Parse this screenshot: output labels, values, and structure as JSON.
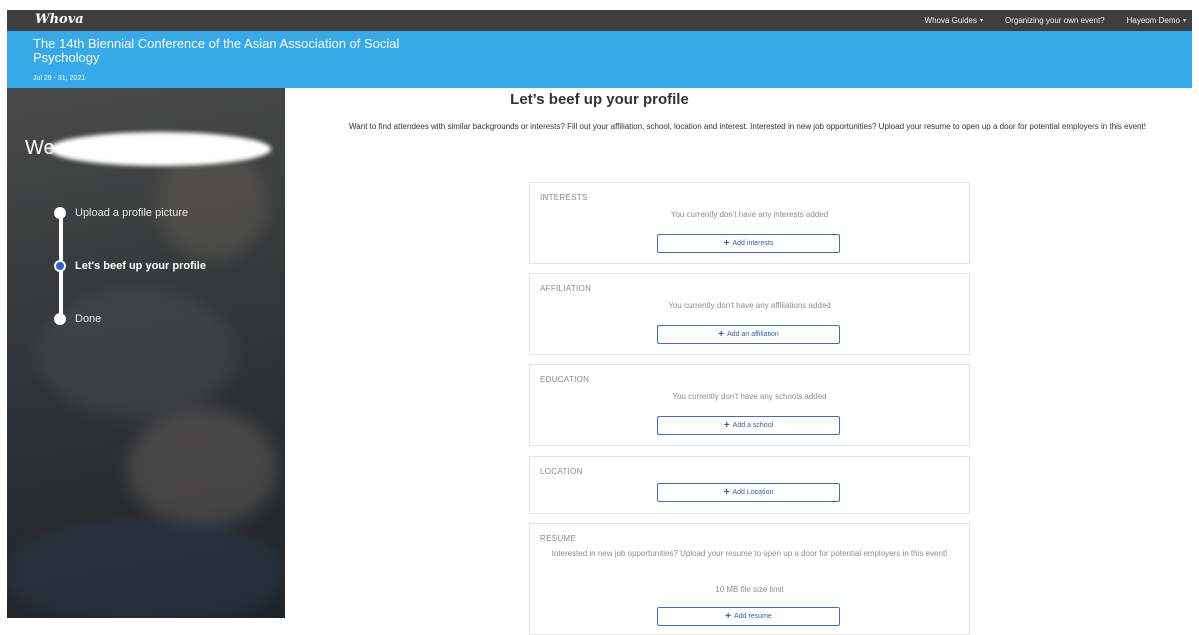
{
  "topbar": {
    "logo": "Whova",
    "nav": [
      {
        "label": "Whova Guides",
        "caret": "▾"
      },
      {
        "label": "Organizing your own event?",
        "caret": ""
      },
      {
        "label": "Hayeom Demo",
        "caret": "▾"
      }
    ]
  },
  "event": {
    "title": "The 14th Biennial Conference of the Asian Association of Social Psychology",
    "dates": "Jul 29 - 31, 2021"
  },
  "sidebar": {
    "welcome": "We                               mo!",
    "steps": [
      {
        "label": "Upload a profile picture",
        "active": false
      },
      {
        "label": "Let's beef up your profile",
        "active": true
      },
      {
        "label": "Done",
        "active": false
      }
    ]
  },
  "main": {
    "title": "Let’s beef up your profile",
    "description": "Want to find attendees with similar backgrounds or interests? Fill out your affiliation, school, location and interest. Interested in new job opportunities? Upload your resume to open up a door for potential employers in this event!",
    "cards": {
      "interests": {
        "label": "INTERESTS",
        "empty": "You currently don't have any interests added",
        "button": "Add interests"
      },
      "affiliation": {
        "label": "AFFILIATION",
        "empty": "You currently don't have any affiliations added",
        "button": "Add an affiliation"
      },
      "education": {
        "label": "EDUCATION",
        "empty": "You currently don't have any schools added",
        "button": "Add a school"
      },
      "location": {
        "label": "LOCATION",
        "button": "Add Location"
      },
      "resume": {
        "label": "RESUME",
        "description": "Interested in new job opportunities? Upload your resume to open up a door for potential employers in this event!",
        "limit": "10 MB file size limit",
        "button": "Add resume"
      }
    }
  },
  "colors": {
    "accent": "#36a9e8",
    "topbar": "#3f3f3f",
    "button": "#3a6fc5",
    "active_step": "#2c62c4"
  },
  "icons": {
    "plus": "+"
  }
}
